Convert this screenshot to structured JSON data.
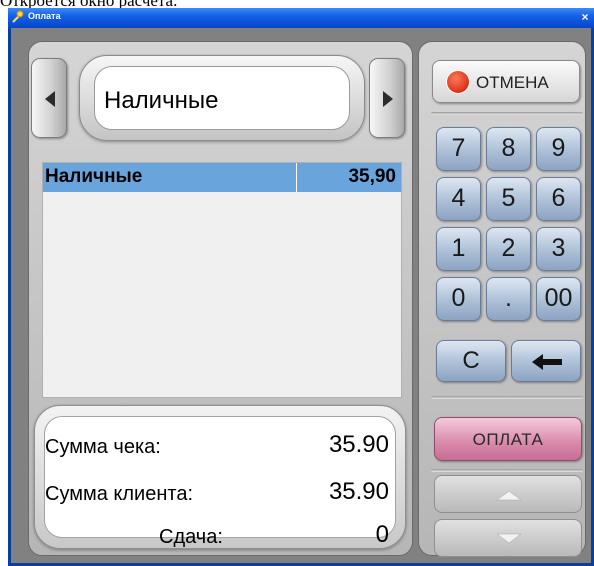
{
  "caption": "Откроется окно расчета.",
  "window": {
    "title": "Оплата",
    "close": "×"
  },
  "payment_method": {
    "selected": "Наличные"
  },
  "payments": [
    {
      "name": "Наличные",
      "amount": "35,90"
    }
  ],
  "summary": {
    "check_label": "Сумма чека:",
    "check_value": "35.90",
    "client_label": "Сумма клиента:",
    "client_value": "35.90",
    "change_label": "Сдача:",
    "change_value": "0"
  },
  "buttons": {
    "cancel": "ОТМЕНА",
    "pay": "ОПЛАТА"
  },
  "keypad": {
    "rows": [
      [
        "7",
        "8",
        "9"
      ],
      [
        "4",
        "5",
        "6"
      ],
      [
        "1",
        "2",
        "3"
      ],
      [
        "0",
        ".",
        "00"
      ]
    ],
    "clear": "C"
  },
  "icons": {
    "prev": "triangle-left-icon",
    "next": "triangle-right-icon",
    "cancel": "stop-hand-icon",
    "backspace": "arrow-left-icon",
    "scroll_up": "triangle-up-icon",
    "scroll_down": "triangle-down-icon"
  },
  "colors": {
    "title_bar": "#1560e8",
    "selection": "#6aa4dc",
    "pay_button": "#d889ab",
    "keypad": "#a8bcd4"
  }
}
